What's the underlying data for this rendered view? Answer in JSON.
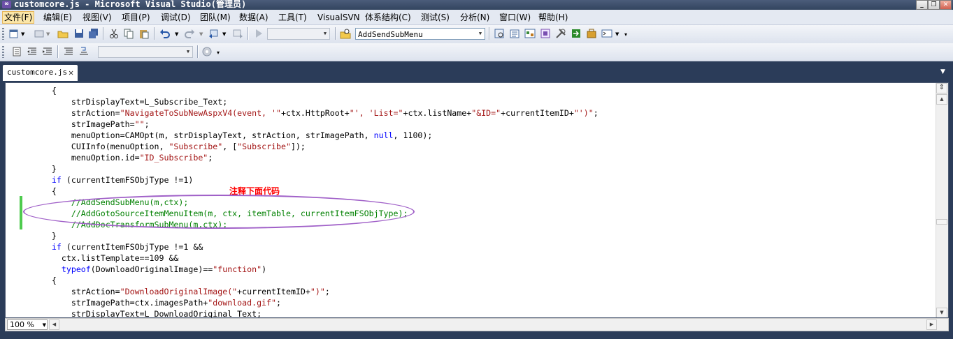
{
  "window": {
    "title": "customcore.js - Microsoft Visual Studio(管理员)",
    "controls": [
      "minimize-icon",
      "restore-icon",
      "close-icon"
    ]
  },
  "menu": {
    "items": [
      "文件(F)",
      "编辑(E)",
      "视图(V)",
      "项目(P)",
      "调试(D)",
      "团队(M)",
      "数据(A)",
      "工具(T)",
      "VisualSVN",
      "体系结构(C)",
      "测试(S)",
      "分析(N)",
      "窗口(W)",
      "帮助(H)"
    ],
    "active_index": 0
  },
  "toolbar": {
    "find_combo_value": "AddSendSubMenu",
    "config_combo_value": "",
    "platform_combo_value": ""
  },
  "tab": {
    "label": "customcore.js"
  },
  "code": {
    "lines": [
      [
        {
          "t": "    {",
          "c": ""
        }
      ],
      [
        {
          "t": "        strDisplayText=L_Subscribe_Text;",
          "c": ""
        }
      ],
      [
        {
          "t": "        strAction=",
          "c": ""
        },
        {
          "t": "\"NavigateToSubNewAspxV4(event, '\"",
          "c": "str"
        },
        {
          "t": "+ctx.HttpRoot+",
          "c": ""
        },
        {
          "t": "\"', 'List=\"",
          "c": "str"
        },
        {
          "t": "+ctx.listName+",
          "c": ""
        },
        {
          "t": "\"&ID=\"",
          "c": "str"
        },
        {
          "t": "+currentItemID+",
          "c": ""
        },
        {
          "t": "\"')\"",
          "c": "str"
        },
        {
          "t": ";",
          "c": ""
        }
      ],
      [
        {
          "t": "        strImagePath=",
          "c": ""
        },
        {
          "t": "\"\"",
          "c": "str"
        },
        {
          "t": ";",
          "c": ""
        }
      ],
      [
        {
          "t": "        menuOption=CAMOpt(m, strDisplayText, strAction, strImagePath, ",
          "c": ""
        },
        {
          "t": "null",
          "c": "kw"
        },
        {
          "t": ", 1100);",
          "c": ""
        }
      ],
      [
        {
          "t": "        CUIInfo(menuOption, ",
          "c": ""
        },
        {
          "t": "\"Subscribe\"",
          "c": "str"
        },
        {
          "t": ", [",
          "c": ""
        },
        {
          "t": "\"Subscribe\"",
          "c": "str"
        },
        {
          "t": "]);",
          "c": ""
        }
      ],
      [
        {
          "t": "        menuOption.id=",
          "c": ""
        },
        {
          "t": "\"ID_Subscribe\"",
          "c": "str"
        },
        {
          "t": ";",
          "c": ""
        }
      ],
      [
        {
          "t": "    }",
          "c": ""
        }
      ],
      [
        {
          "t": "    ",
          "c": ""
        },
        {
          "t": "if",
          "c": "kw"
        },
        {
          "t": " (currentItemFSObjType !=1)",
          "c": ""
        }
      ],
      [
        {
          "t": "    {",
          "c": ""
        }
      ],
      [
        {
          "t": "        //AddSendSubMenu(m,ctx);",
          "c": "cm"
        }
      ],
      [
        {
          "t": "        //AddGotoSourceItemMenuItem(m, ctx, itemTable, currentItemFSObjType);",
          "c": "cm"
        }
      ],
      [
        {
          "t": "        //AddDocTransformSubMenu(m,ctx);",
          "c": "cm"
        }
      ],
      [
        {
          "t": "    }",
          "c": ""
        }
      ],
      [
        {
          "t": "    ",
          "c": ""
        },
        {
          "t": "if",
          "c": "kw"
        },
        {
          "t": " (currentItemFSObjType !=1 &&",
          "c": ""
        }
      ],
      [
        {
          "t": "      ctx.listTemplate==109 &&",
          "c": ""
        }
      ],
      [
        {
          "t": "      ",
          "c": ""
        },
        {
          "t": "typeof",
          "c": "kw"
        },
        {
          "t": "(DownloadOriginalImage)==",
          "c": ""
        },
        {
          "t": "\"function\"",
          "c": "str"
        },
        {
          "t": ")",
          "c": ""
        }
      ],
      [
        {
          "t": "    {",
          "c": ""
        }
      ],
      [
        {
          "t": "        strAction=",
          "c": ""
        },
        {
          "t": "\"DownloadOriginalImage(\"",
          "c": "str"
        },
        {
          "t": "+currentItemID+",
          "c": ""
        },
        {
          "t": "\")\"",
          "c": "str"
        },
        {
          "t": ";",
          "c": ""
        }
      ],
      [
        {
          "t": "        strImagePath=ctx.imagesPath+",
          "c": ""
        },
        {
          "t": "\"download.gif\"",
          "c": "str"
        },
        {
          "t": ";",
          "c": ""
        }
      ],
      [
        {
          "t": "        strDisplayText=L_DownloadOriginal_Text;",
          "c": ""
        }
      ]
    ]
  },
  "annotation": {
    "text": "注释下面代码"
  },
  "statusbar": {
    "zoom": "100 %"
  },
  "colors": {
    "keyword": "#0000ff",
    "string": "#a31515",
    "comment": "#008000",
    "annotation": "#ff0000",
    "ellipse": "#a060c8",
    "changebar": "#4ecb4e"
  }
}
